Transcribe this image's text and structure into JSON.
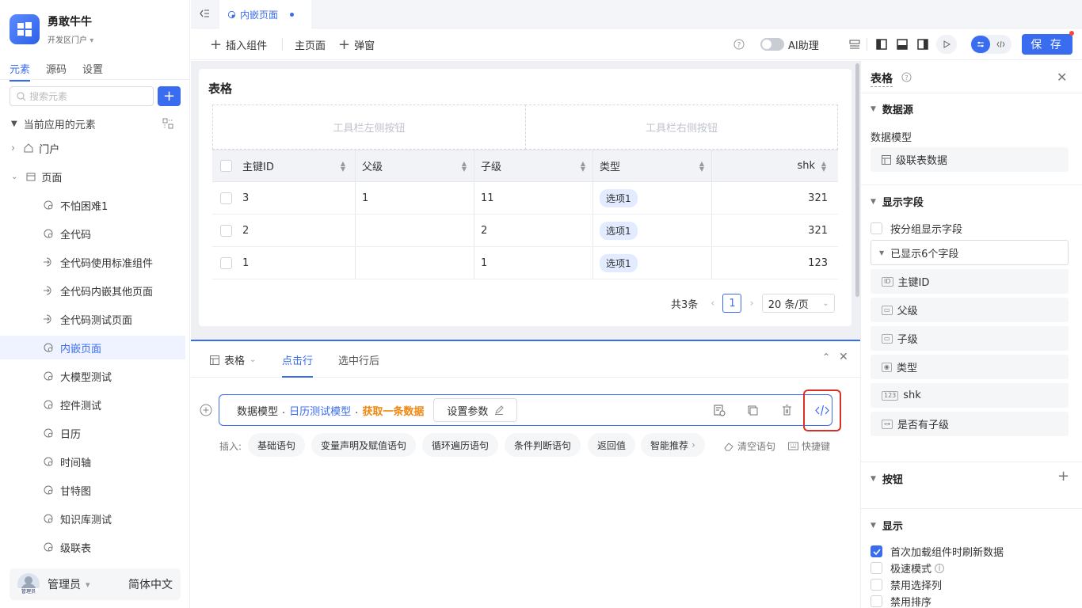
{
  "app": {
    "name": "勇敢牛牛",
    "portal": "开发区门户"
  },
  "sidebar": {
    "tabs": [
      "元素",
      "源码",
      "设置"
    ],
    "search_placeholder": "搜索元素",
    "section": "当前应用的元素",
    "portal_node": "门户",
    "pages_node": "页面",
    "pages": [
      "不怕困难1",
      "全代码",
      "全代码使用标准组件",
      "全代码内嵌其他页面",
      "全代码测试页面",
      "内嵌页面",
      "大模型测试",
      "控件测试",
      "日历",
      "时间轴",
      "甘特图",
      "知识库测试",
      "级联表"
    ],
    "selected_page": "内嵌页面",
    "user": "管理员",
    "avatar_text": "管理员",
    "language": "简体中文"
  },
  "tabbar": {
    "active_tab": "内嵌页面"
  },
  "toolbar": {
    "insert": "插入组件",
    "main_page": "主页面",
    "popup": "弹窗",
    "ai": "AI助理",
    "save": "保 存"
  },
  "table": {
    "title": "表格",
    "toolbar_left": "工具栏左侧按钮",
    "toolbar_right": "工具栏右侧按钮",
    "columns": [
      "主键ID",
      "父级",
      "子级",
      "类型",
      "shk"
    ],
    "rows": [
      {
        "id": "3",
        "parent": "1",
        "child": "11",
        "type": "选项1",
        "shk": "321"
      },
      {
        "id": "2",
        "parent": "",
        "child": "2",
        "type": "选项1",
        "shk": "321"
      },
      {
        "id": "1",
        "parent": "",
        "child": "1",
        "type": "选项1",
        "shk": "123"
      }
    ],
    "total": "共3条",
    "page": "1",
    "page_size": "20 条/页"
  },
  "bottom": {
    "tabs": [
      "表格",
      "点击行",
      "选中行后"
    ],
    "active_tab": "点击行",
    "expr_prefix": "数据模型",
    "expr_model": "日历测试模型",
    "expr_action": "获取一条数据",
    "set_params": "设置参数",
    "insert_label": "插入:",
    "insert_buttons": [
      "基础语句",
      "变量声明及赋值语句",
      "循环遍历语句",
      "条件判断语句",
      "返回值",
      "智能推荐"
    ],
    "clear": "清空语句",
    "shortcut": "快捷键"
  },
  "props": {
    "title": "表格",
    "datasource": "数据源",
    "model_label": "数据模型",
    "model_value": "级联表数据",
    "display_fields": "显示字段",
    "group_display": "按分组显示字段",
    "shown_count": "已显示6个字段",
    "fields": [
      "主键ID",
      "父级",
      "子级",
      "类型",
      "shk",
      "是否有子级"
    ],
    "buttons": "按钮",
    "display": "显示",
    "options": [
      {
        "label": "首次加载组件时刷新数据",
        "checked": true
      },
      {
        "label": "极速模式",
        "checked": false
      },
      {
        "label": "禁用选择列",
        "checked": false
      },
      {
        "label": "禁用排序",
        "checked": false
      }
    ]
  },
  "colors": {
    "accent": "#3a6cf0",
    "highlight": "#f0870d",
    "annotation": "#d93025"
  }
}
